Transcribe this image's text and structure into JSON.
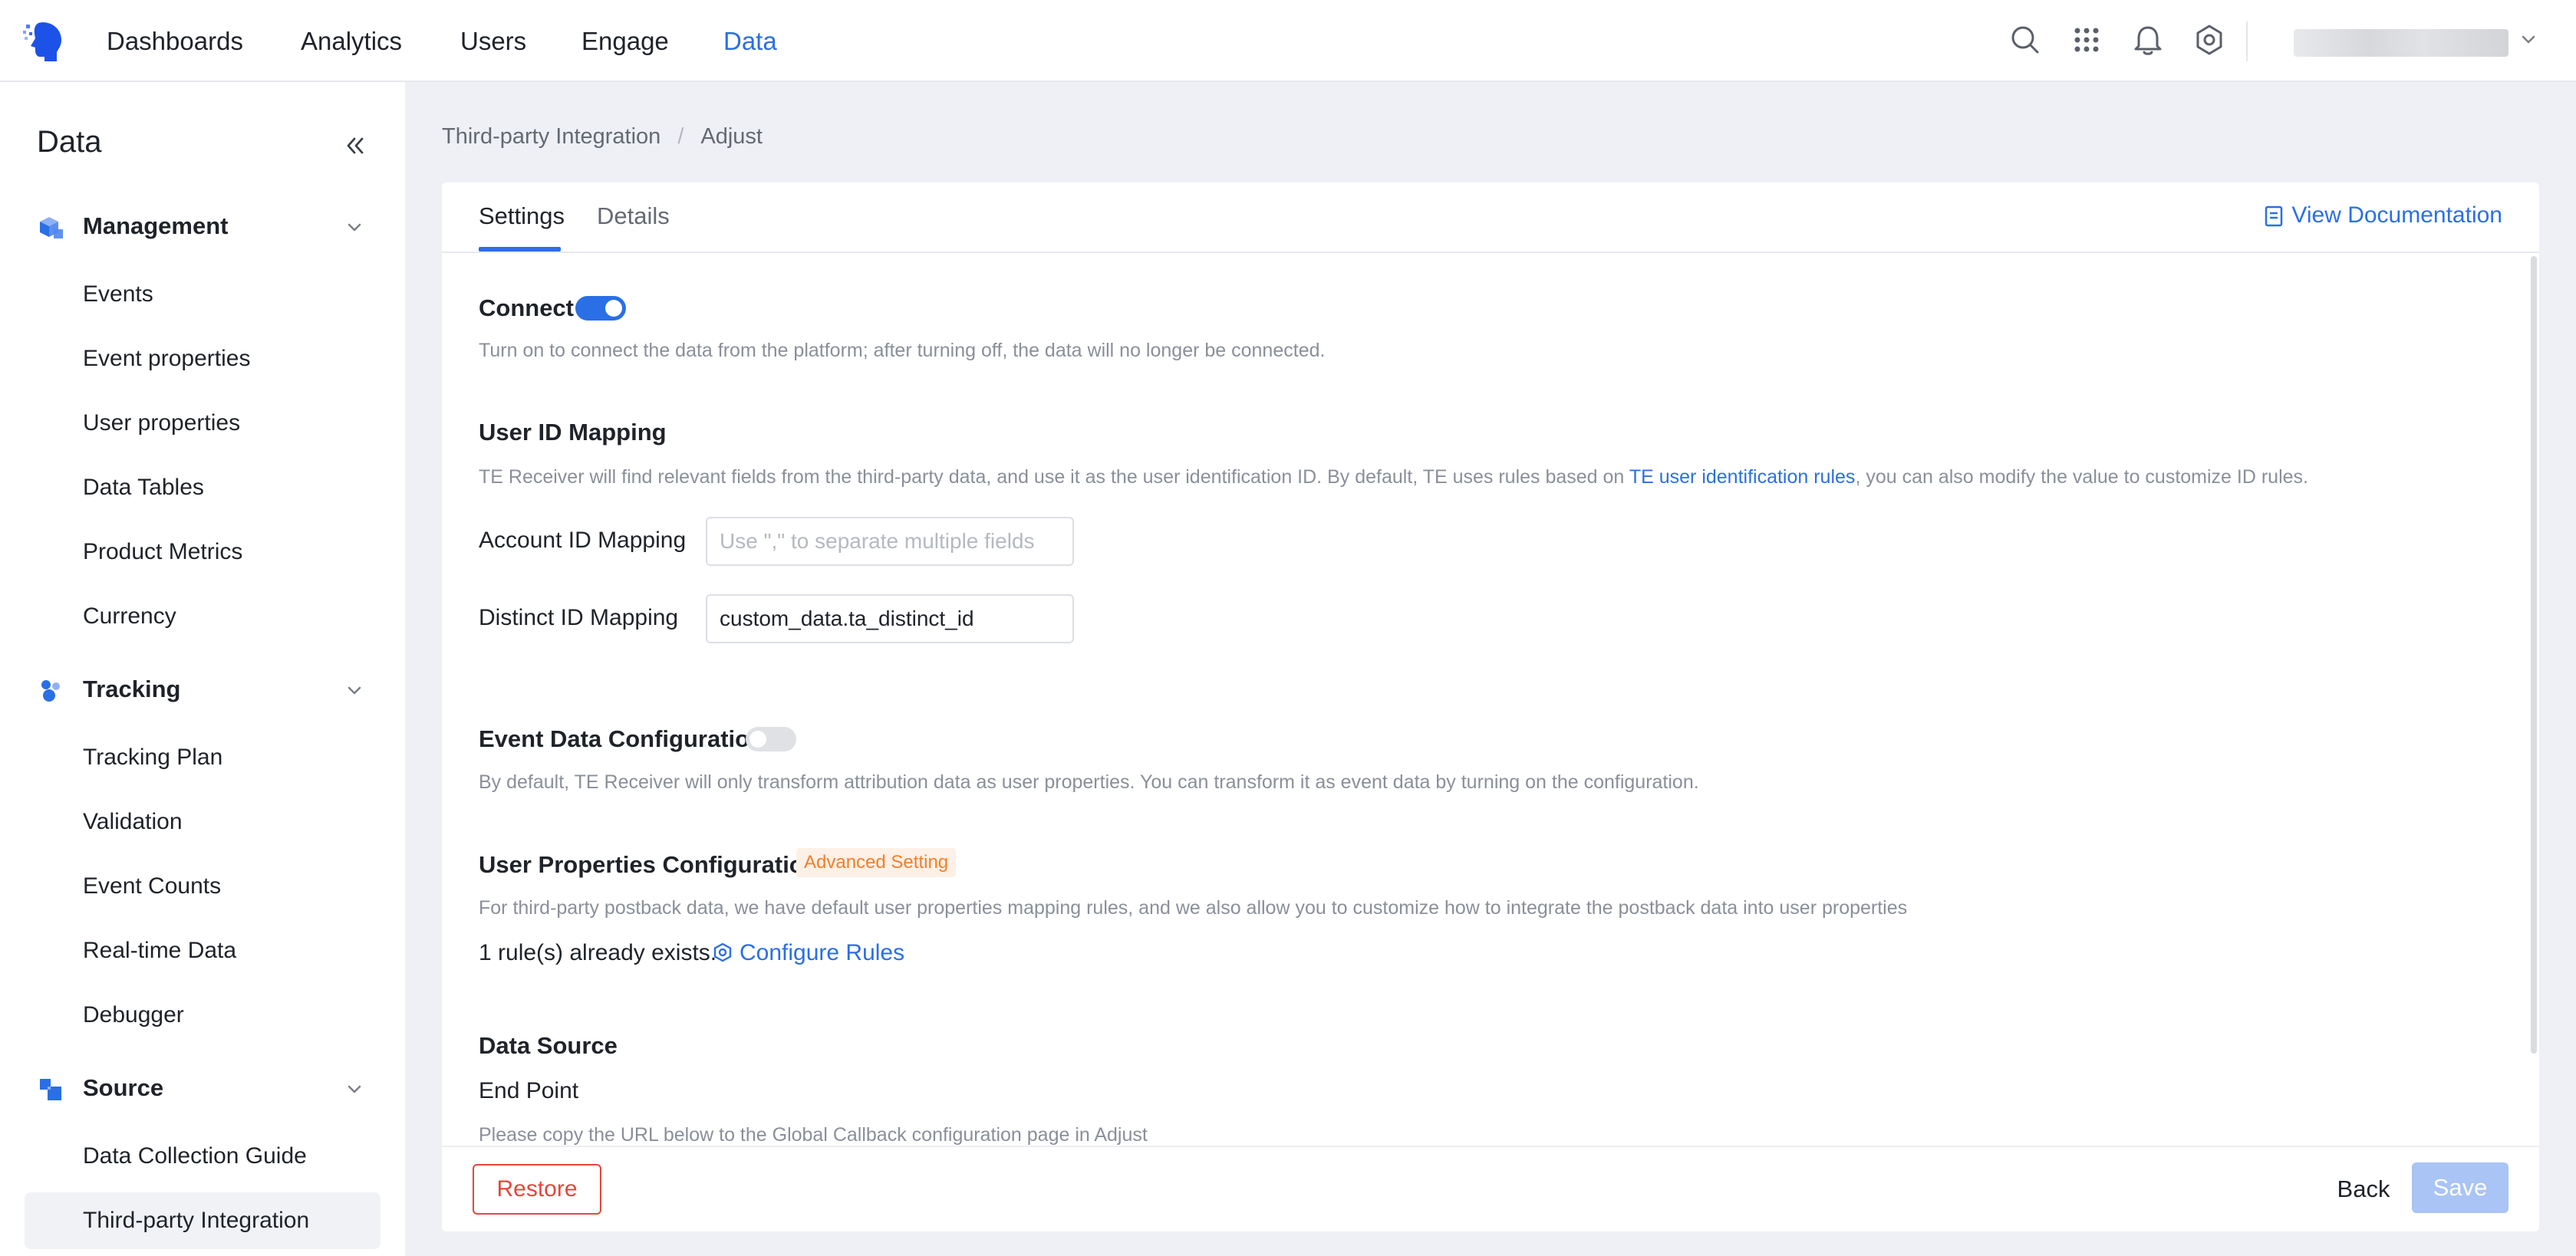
{
  "topnav": {
    "items": [
      {
        "label": "Dashboards",
        "active": false
      },
      {
        "label": "Analytics",
        "active": false
      },
      {
        "label": "Users",
        "active": false
      },
      {
        "label": "Engage",
        "active": false
      },
      {
        "label": "Data",
        "active": true
      }
    ],
    "icons": [
      "search-icon",
      "apps-grid-icon",
      "bell-icon",
      "settings-gear-icon",
      "chevron-down-icon"
    ],
    "accent_color": "#2a6fe5"
  },
  "sidebar": {
    "title": "Data",
    "groups": [
      {
        "label": "Management",
        "icon": "cube-icon",
        "items": [
          "Events",
          "Event properties",
          "User properties",
          "Data Tables",
          "Product Metrics",
          "Currency"
        ]
      },
      {
        "label": "Tracking",
        "icon": "tracking-icon",
        "items": [
          "Tracking Plan",
          "Validation",
          "Event Counts",
          "Real-time Data",
          "Debugger"
        ]
      },
      {
        "label": "Source",
        "icon": "source-icon",
        "items": [
          "Data Collection Guide",
          "Third-party Integration"
        ]
      }
    ],
    "active_item": "Third-party Integration"
  },
  "breadcrumb": {
    "parent": "Third-party Integration",
    "separator": "/",
    "current": "Adjust"
  },
  "tabs": [
    {
      "label": "Settings",
      "active": true
    },
    {
      "label": "Details",
      "active": false
    }
  ],
  "view_documentation": "View Documentation",
  "connect": {
    "title": "Connect",
    "enabled": true,
    "description": "Turn on to connect the data from the platform; after turning off, the data will no longer be connected."
  },
  "user_id_mapping": {
    "title": "User ID Mapping",
    "description_before": "TE Receiver will find relevant fields from the third-party data, and use it as the user identification ID. By default, TE uses rules based on ",
    "description_link": "TE user identification rules",
    "description_after": ", you can also modify the value to customize ID rules.",
    "account_label": "Account ID Mapping",
    "account_placeholder": "Use \",\" to separate multiple fields",
    "account_value": "",
    "distinct_label": "Distinct ID Mapping",
    "distinct_value": "custom_data.ta_distinct_id"
  },
  "event_data": {
    "title": "Event Data Configuration",
    "enabled": false,
    "description": "By default, TE Receiver will only transform attribution data as user properties. You can transform it as event data by turning on the configuration."
  },
  "user_properties": {
    "title": "User Properties Configuration",
    "badge": "Advanced Setting",
    "description": "For third-party postback data, we have default user properties mapping rules, and we also allow you to customize how to integrate the postback data into user properties",
    "rules_text": "1 rule(s) already exists.",
    "configure_label": "Configure Rules"
  },
  "data_source": {
    "title": "Data Source",
    "endpoint_label": "End Point",
    "endpoint_description": "Please copy the URL below to the Global Callback configuration page in Adjust"
  },
  "footer": {
    "restore": "Restore",
    "back": "Back",
    "save": "Save"
  }
}
